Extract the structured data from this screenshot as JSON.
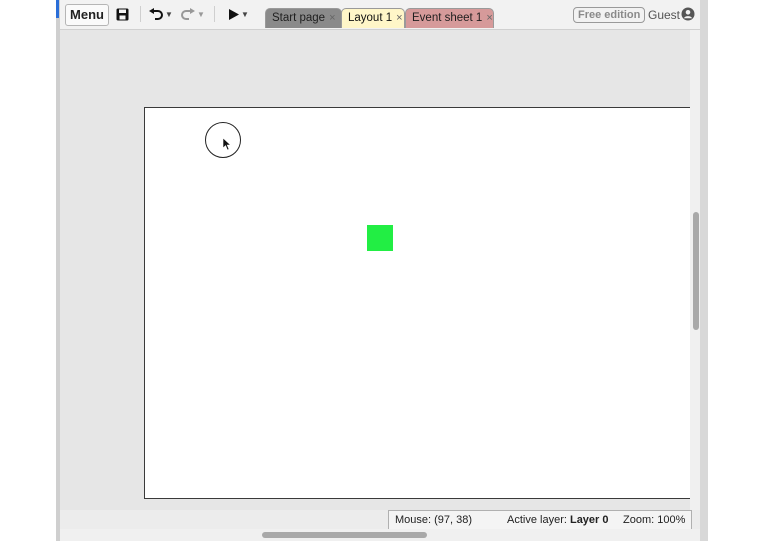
{
  "toolbar": {
    "menu_label": "Menu",
    "icons": [
      "save-icon",
      "undo-icon",
      "redo-icon",
      "play-icon"
    ]
  },
  "tabs": [
    {
      "label": "Start page",
      "close": "×",
      "color": "#8a8a8a"
    },
    {
      "label": "Layout 1",
      "close": "×",
      "color": "#fff6c8",
      "active": true
    },
    {
      "label": "Event sheet 1",
      "close": "×",
      "color": "#d69a9a"
    }
  ],
  "account": {
    "edition_badge": "Free edition",
    "user_label": "Guest"
  },
  "layout": {
    "sprite_color": "#22ee44",
    "background": "#ffffff"
  },
  "status": {
    "mouse_label": "Mouse: (97, 38)",
    "active_layer_label": "Active layer: ",
    "active_layer_value": "Layer 0",
    "zoom_label": "Zoom: 100%"
  }
}
